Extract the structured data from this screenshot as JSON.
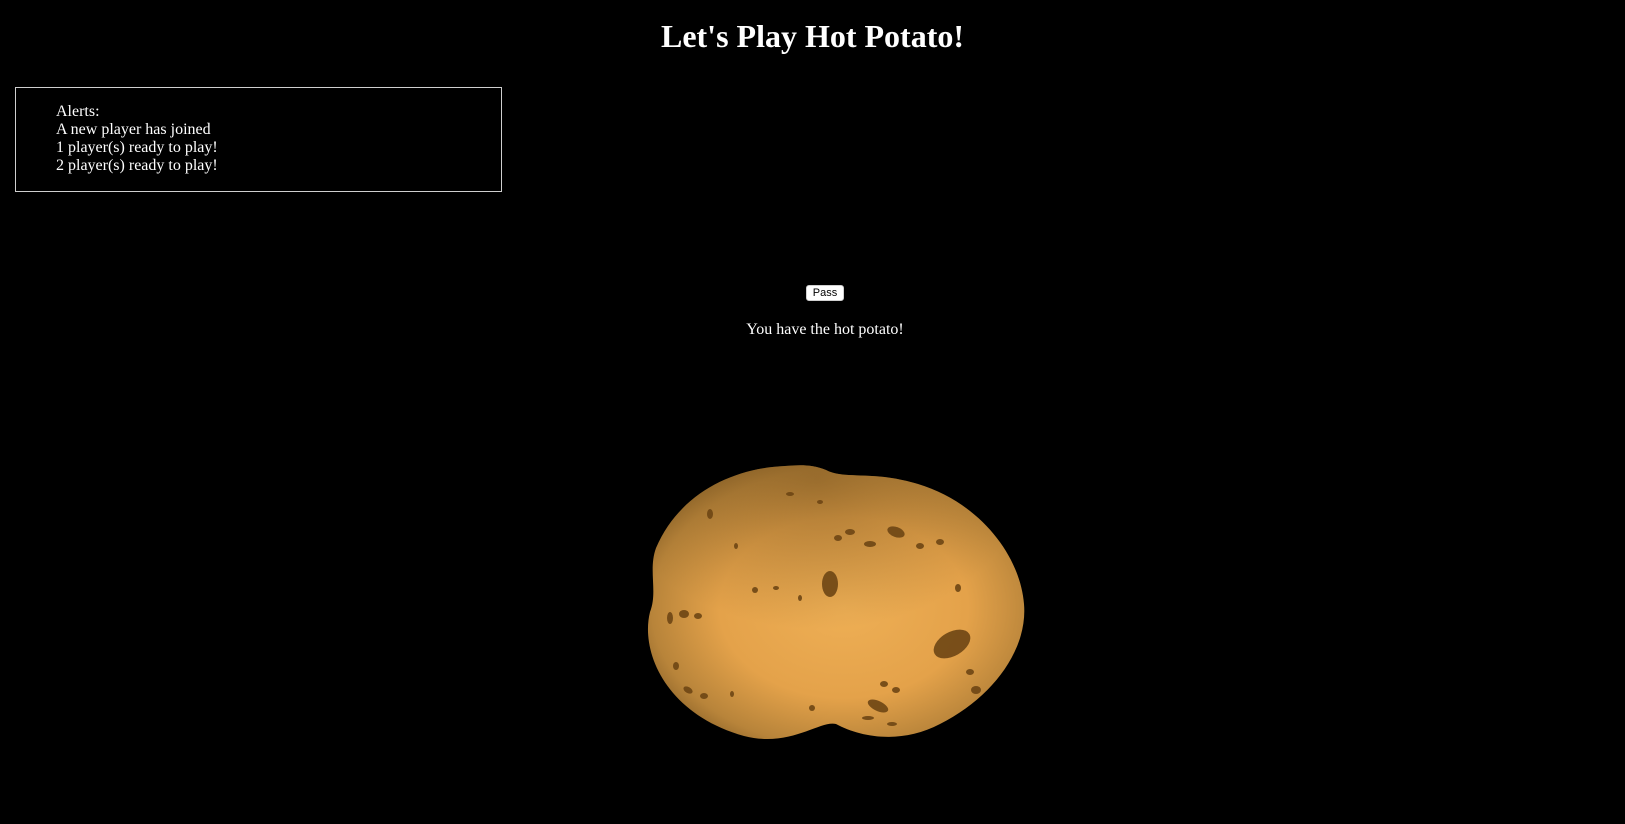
{
  "page": {
    "title": "Let's Play Hot Potato!"
  },
  "alerts": {
    "heading": "Alerts:",
    "items": [
      "A new player has joined",
      "1 player(s) ready to play!",
      "2 player(s) ready to play!"
    ]
  },
  "controls": {
    "pass_label": "Pass"
  },
  "status": {
    "message": "You have the hot potato!"
  },
  "potato": {
    "icon": "potato-icon",
    "colors": {
      "skin": "#e9a84e",
      "shadow": "#9a6a2e",
      "spots": "#6e4614"
    }
  }
}
